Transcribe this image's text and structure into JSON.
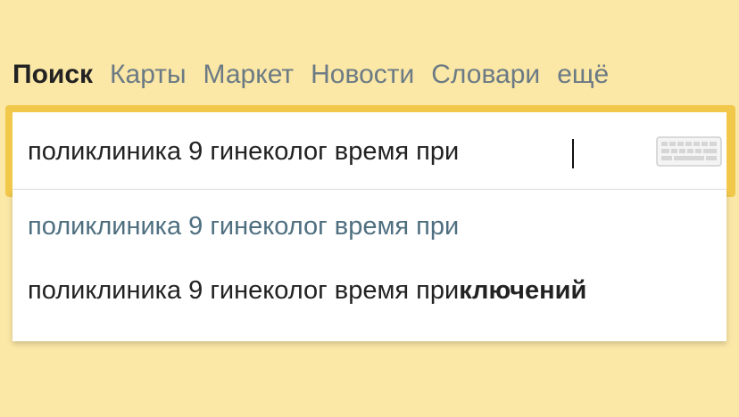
{
  "nav": {
    "tabs": [
      {
        "label": "Поиск",
        "active": true
      },
      {
        "label": "Карты"
      },
      {
        "label": "Маркет"
      },
      {
        "label": "Новости"
      },
      {
        "label": "Словари"
      },
      {
        "label": "ещё"
      }
    ]
  },
  "search": {
    "value": "поликлиника 9 гинеколог время при",
    "keyboard_icon": "keyboard-icon"
  },
  "suggestions": [
    {
      "text": "поликлиника 9 гинеколог время при"
    },
    {
      "prefix": "поликлиника 9 гинеколог время при",
      "completion": "ключений"
    }
  ],
  "colors": {
    "background": "#fbe7a6",
    "frame": "#f2c84b",
    "suggestion_link": "#4f6f80"
  }
}
